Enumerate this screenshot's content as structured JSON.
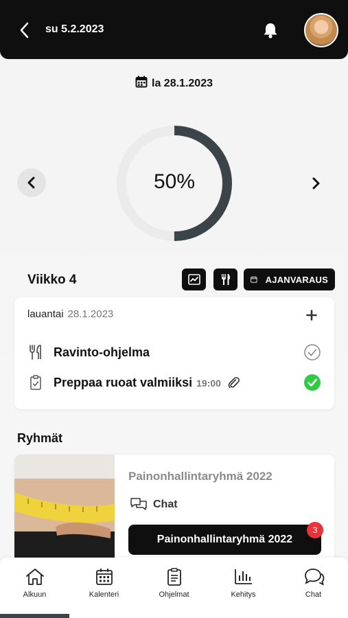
{
  "header": {
    "date": "su 5.2.2023",
    "icons": {
      "back": "chevron-left-icon",
      "notifications": "bell-icon",
      "avatar": "user-avatar"
    }
  },
  "day_selector": {
    "date": "la 28.1.2023",
    "progress_label": "50%",
    "progress_value": 0.5
  },
  "week": {
    "title": "Viikko 4",
    "booking_label": "AJANVARAUS"
  },
  "day_card": {
    "weekday": "lauantai",
    "date": "28.1.2023",
    "tasks": [
      {
        "label": "Ravinto-ohjelma",
        "time": "",
        "status": "pending",
        "icon": "cutlery-icon"
      },
      {
        "label": "Preppaa ruoat valmiiksi",
        "time": "19:00",
        "status": "done",
        "icon": "clipboard-icon"
      }
    ]
  },
  "groups": {
    "title": "Ryhmät",
    "card": {
      "name": "Painonhallintaryhmä 2022",
      "chat_label": "Chat",
      "button_label": "Painonhallintaryhmä 2022",
      "badge_count": "3"
    }
  },
  "bottom_nav": {
    "items": [
      {
        "label": "Alkuun"
      },
      {
        "label": "Kalenteri"
      },
      {
        "label": "Ohjelmat"
      },
      {
        "label": "Kehitys"
      },
      {
        "label": "Chat"
      }
    ],
    "active_index": 0
  },
  "colors": {
    "accent_dark": "#0f0f10",
    "progress": "#3b4448",
    "success": "#2ecc40",
    "badge": "#e8333b"
  }
}
